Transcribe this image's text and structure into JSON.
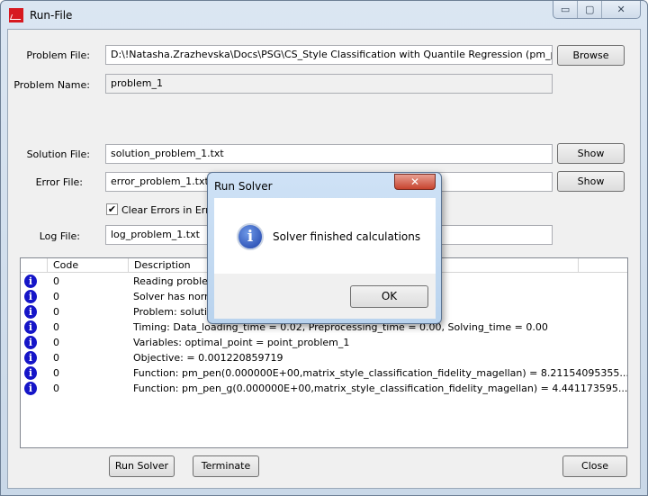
{
  "window": {
    "title": "Run-File",
    "minimize": "▭",
    "maximize": "▢",
    "close": "✕"
  },
  "form": {
    "problem_file_label": "Problem File:",
    "problem_file_value": "D:\\!Natasha.Zrazhevska\\Docs\\PSG\\CS_Style Classification with Quantile Regression (pm_pen pm_pen",
    "browse": "Browse",
    "problem_name_label": "Problem Name:",
    "problem_name_value": "problem_1",
    "solution_file_label": "Solution File:",
    "solution_file_value": "solution_problem_1.txt",
    "error_file_label": "Error File:",
    "error_file_value": "error_problem_1.txt",
    "show": "Show",
    "clear_errors_label": "Clear Errors in Error",
    "clear_errors_checked": true,
    "checkmark": "✔",
    "log_file_label": "Log File:",
    "log_file_value": "log_problem_1.txt"
  },
  "table": {
    "headers": [
      "",
      "Code",
      "Description",
      ""
    ],
    "rows": [
      {
        "code": "0",
        "description": "Reading problem"
      },
      {
        "code": "0",
        "description": "Solver has norma"
      },
      {
        "code": "0",
        "description": "Problem: solution"
      },
      {
        "code": "0",
        "description": "Timing: Data_loading_time = 0.02, Preprocessing_time = 0.00, Solving_time = 0.00"
      },
      {
        "code": "0",
        "description": "Variables: optimal_point = point_problem_1"
      },
      {
        "code": "0",
        "description": "Objective:   = 0.001220859719"
      },
      {
        "code": "0",
        "description": "Function: pm_pen(0.000000E+00,matrix_style_classification_fidelity_magellan) = 8.21154095355..."
      },
      {
        "code": "0",
        "description": "Function: pm_pen_g(0.000000E+00,matrix_style_classification_fidelity_magellan) = 4.441173595..."
      }
    ],
    "row_icon": "info-icon"
  },
  "buttons": {
    "run_solver": "Run Solver",
    "terminate": "Terminate",
    "close": "Close"
  },
  "dialog": {
    "title": "Run Solver",
    "close": "✕",
    "message": "Solver finished calculations",
    "ok": "OK",
    "icon": "info-icon"
  }
}
